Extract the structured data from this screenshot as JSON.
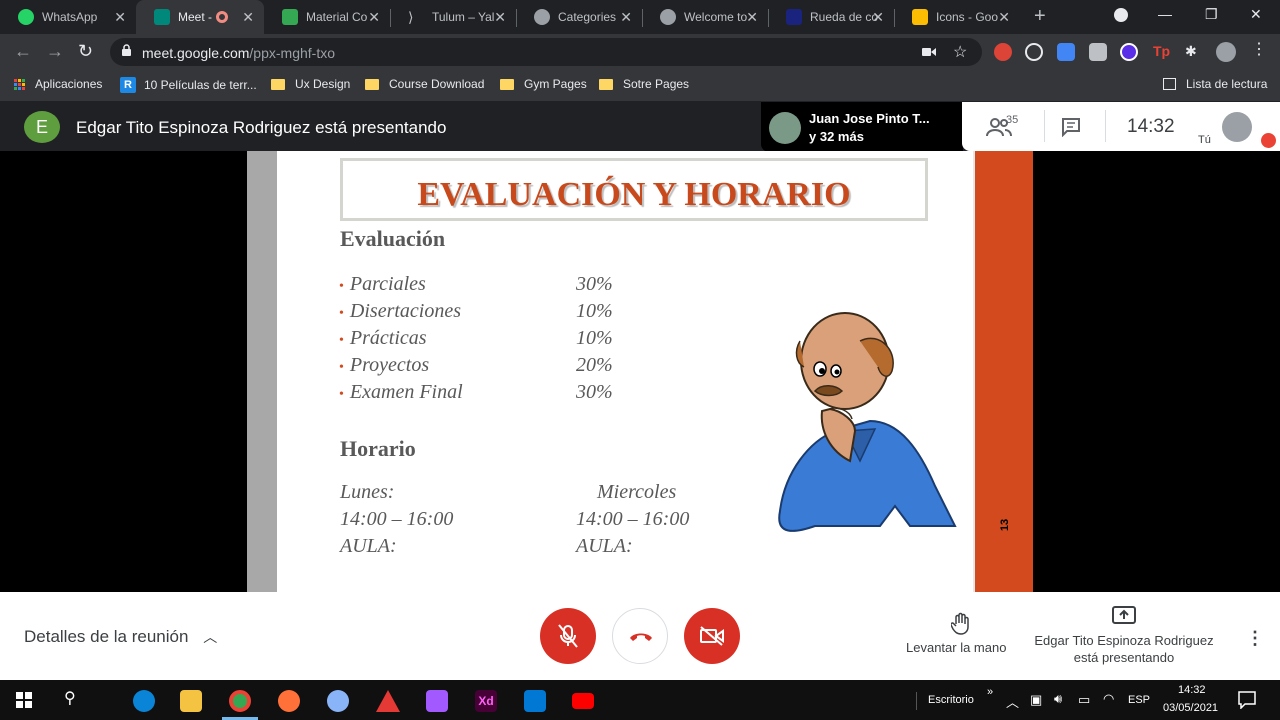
{
  "browser": {
    "tabs": [
      {
        "label": "WhatsApp",
        "color": "#25d366"
      },
      {
        "label": "Meet - ",
        "color": "#00897b",
        "active": true
      },
      {
        "label": "Material Co",
        "color": "#34a853"
      },
      {
        "label": "Tulum – Yal",
        "color": "#202124"
      },
      {
        "label": "Categories",
        "color": "#9aa0a6"
      },
      {
        "label": "Welcome to",
        "color": "#9aa0a6"
      },
      {
        "label": "Rueda de co",
        "color": "#1a237e"
      },
      {
        "label": "Icons - Goo",
        "color": "#fbbc04"
      }
    ],
    "url_domain": "meet.google.com",
    "url_path": "/ppx-mghf-txo",
    "bookmarks": [
      "Aplicaciones",
      "10 Películas de terr...",
      "Ux Design",
      "Course Download",
      "Gym Pages",
      "Sotre Pages"
    ],
    "reading_list": "Lista de lectura"
  },
  "meet": {
    "presenter_initial": "E",
    "presenting_text": "Edgar Tito Espinoza Rodriguez está presentando",
    "speaker_name": "Juan Jose Pinto T...",
    "speaker_more": "y 32 más",
    "participants_count": "35",
    "time": "14:32",
    "you_label": "Tú"
  },
  "slide": {
    "title": "EVALUACIÓN Y HORARIO",
    "section1": "Evaluación",
    "items": [
      {
        "name": "Parciales",
        "pct": "30%"
      },
      {
        "name": "Disertaciones",
        "pct": "10%"
      },
      {
        "name": "Prácticas",
        "pct": "10%"
      },
      {
        "name": "Proyectos",
        "pct": "20%"
      },
      {
        "name": "Examen Final",
        "pct": "30%"
      }
    ],
    "section2": "Horario",
    "day1": "Lunes:",
    "day2": "Miercoles",
    "time1": "14:00 – 16:00",
    "time2": "14:00 – 16:00",
    "room1": "AULA:",
    "room2": "AULA:",
    "page_number": "13"
  },
  "controls": {
    "details": "Detalles de la reunión",
    "raise_hand": "Levantar la mano",
    "presenting": "Edgar Tito Espinoza Rodriguez está presentando"
  },
  "taskbar": {
    "desktop": "Escritorio",
    "lang": "ESP",
    "time": "14:32",
    "date": "03/05/2021"
  }
}
